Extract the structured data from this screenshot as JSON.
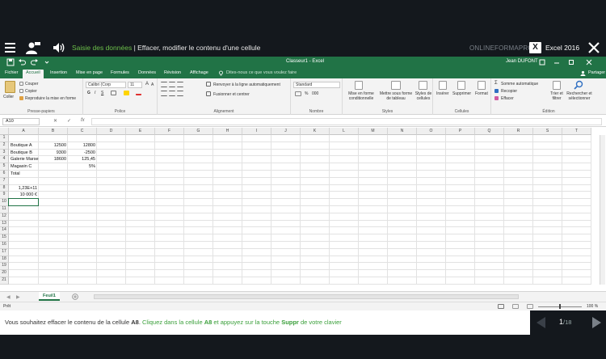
{
  "course": {
    "section": "Saisie des données",
    "separator": " | ",
    "lesson": "Effacer, modifier le contenu d'une cellule",
    "brand": "ONLINEFORMAPRO",
    "app_name": "Excel 2016",
    "accent_color": "#6cc04a"
  },
  "window": {
    "title": "Classeur1 - Excel",
    "user": "Jean DUFONT",
    "brand_color": "#217346"
  },
  "tabs": [
    "Fichier",
    "Accueil",
    "Insertion",
    "Mise en page",
    "Formules",
    "Données",
    "Révision",
    "Affichage"
  ],
  "active_tab": "Accueil",
  "search_placeholder": "Dites-nous ce que vous voulez faire",
  "share_label": "Partager",
  "ribbon": {
    "clipboard": {
      "paste": "Coller",
      "cut": "Couper",
      "copy": "Copier",
      "format_painter": "Reproduire la mise en forme",
      "label": "Presse-papiers"
    },
    "font": {
      "name": "Calibri (Corp",
      "size": "11",
      "bold": "G",
      "italic": "I",
      "underline": "S",
      "label": "Police"
    },
    "alignment": {
      "wrap": "Renvoyer à la ligne automatiquement",
      "merge": "Fusionner et centrer",
      "label": "Alignement"
    },
    "number": {
      "format": "Standard",
      "label": "Nombre"
    },
    "styles": {
      "conditional": "Mise en forme conditionnelle",
      "table": "Mettre sous forme de tableau",
      "cell_styles": "Styles de cellules",
      "label": "Styles"
    },
    "cells": {
      "insert": "Insérer",
      "delete": "Supprimer",
      "format": "Format",
      "label": "Cellules"
    },
    "editing": {
      "autosum": "Somme automatique",
      "fill": "Recopier",
      "clear": "Effacer",
      "sort": "Trier et filtrer",
      "find": "Rechercher et sélectionner",
      "label": "Édition"
    }
  },
  "name_box": "A10",
  "formula_value": "",
  "columns": [
    "A",
    "B",
    "C",
    "D",
    "E",
    "F",
    "G",
    "H",
    "I",
    "J",
    "K",
    "L",
    "M",
    "N",
    "O",
    "P",
    "Q",
    "R",
    "S",
    "T"
  ],
  "rows": [
    "1",
    "2",
    "3",
    "4",
    "5",
    "6",
    "7",
    "8",
    "9",
    "10",
    "11",
    "12",
    "13",
    "14",
    "15",
    "16",
    "17",
    "18",
    "19",
    "20",
    "21"
  ],
  "cells": {
    "A2": "Boutique A",
    "B2": "12500",
    "C2": "12800",
    "A3": "Boutique B",
    "B3": "9300",
    "C3": "-2500",
    "A4": "Galerie Marse",
    "B4": "18600",
    "C4": "125,45",
    "A5": "Magasin C",
    "C5": "5%",
    "A6": "Total",
    "A8": "1,23E+11",
    "A9": "10 000 €"
  },
  "sheet_tab": "Feuil1",
  "status": {
    "ready": "Prêt",
    "zoom": "100 %"
  },
  "instruction": {
    "part1": "Vous souhaitez effacer le contenu de la cellule ",
    "cell1": "A8",
    "part2": ". ",
    "part3": "Cliquez dans la cellule ",
    "cell2": "A8",
    "part4": " et appuyez sur la touche ",
    "key": "Suppr",
    "part5": " de votre clavier"
  },
  "pager": {
    "current": "1",
    "total": "/18"
  }
}
